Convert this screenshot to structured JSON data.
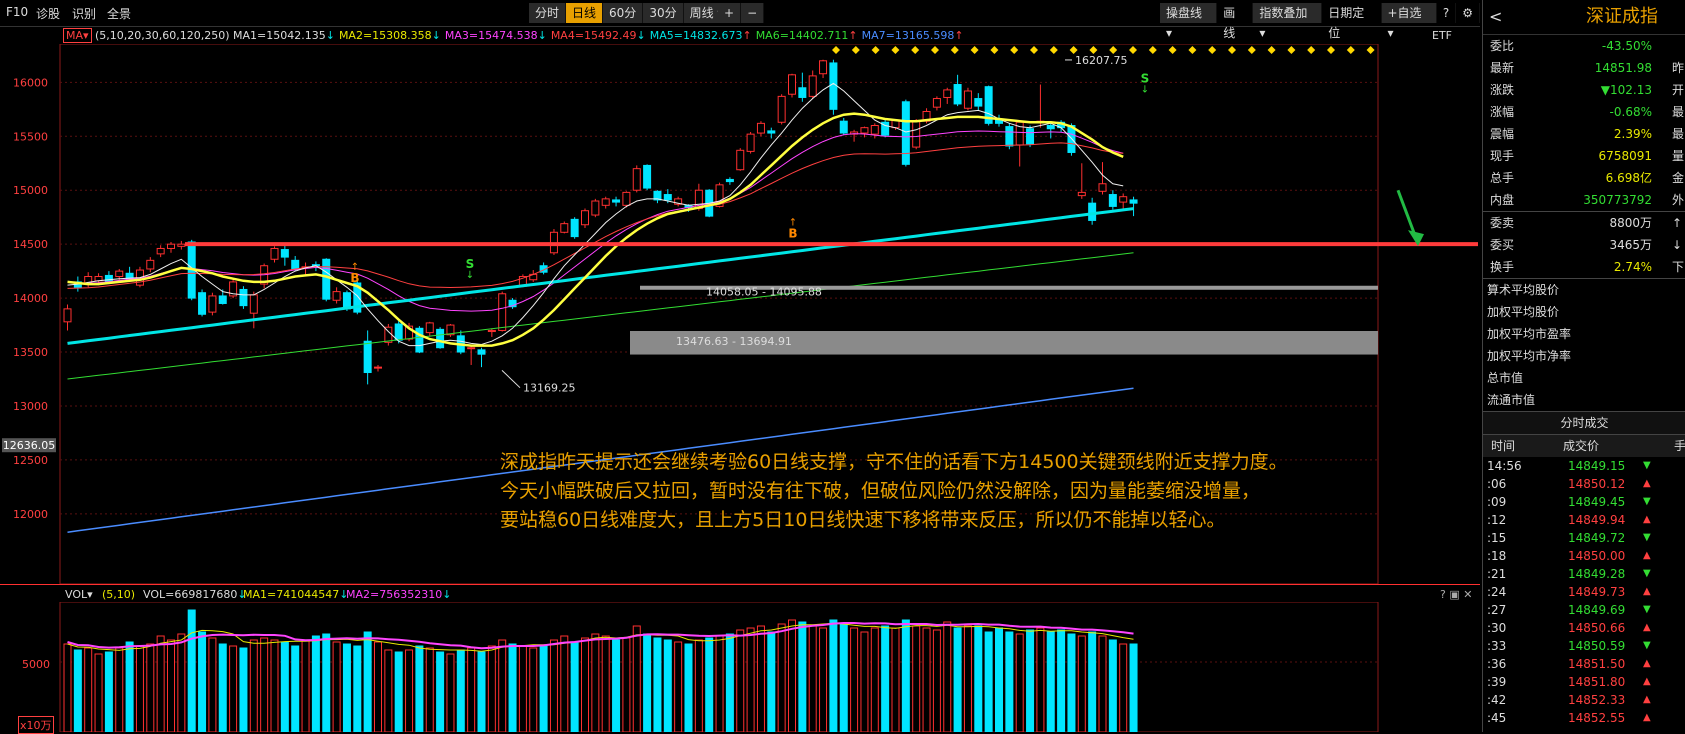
{
  "toolbar": {
    "f10": "F10",
    "diagnose": "诊股",
    "identify": "识别",
    "fullscreen": "全景",
    "periods": [
      "分时",
      "日线",
      "60分",
      "30分",
      "周线"
    ],
    "period_active": 1,
    "plus": "+",
    "minus": "−",
    "right_buttons": [
      "操盘线",
      "画线",
      "指数叠加",
      "日期定位",
      "+自选"
    ],
    "help": "?",
    "settings": "⚙"
  },
  "ma_bar": {
    "selector": "MA",
    "params": "(5,10,20,30,60,120,250)",
    "items": [
      {
        "text": "MA1=15042.135",
        "arrow": "↓",
        "color": "#dddddd"
      },
      {
        "text": "MA2=15308.358",
        "arrow": "↓",
        "color": "#e8e800"
      },
      {
        "text": "MA3=15474.538",
        "arrow": "↓",
        "color": "#ff44ff"
      },
      {
        "text": "MA4=15492.49",
        "arrow": "↓",
        "color": "#ff4040"
      },
      {
        "text": "MA5=14832.673",
        "arrow": "↑",
        "color": "#00e5e5"
      },
      {
        "text": "MA6=14402.711",
        "arrow": "↑",
        "color": "#33dd33"
      },
      {
        "text": "MA7=13165.598",
        "arrow": "↑",
        "color": "#4a8cff"
      }
    ],
    "etf": "ETF"
  },
  "chart": {
    "y_ticks": [
      "16000",
      "15500",
      "15000",
      "14500",
      "14000",
      "13500",
      "13000",
      "12500",
      "12000"
    ],
    "current_price_tag": "12636.05",
    "labels": {
      "high": "16207.75",
      "low": "13169.25",
      "zone1": "14058.05 - 14095.88",
      "zone2": "13476.63 - 13694.91"
    },
    "signals": [
      "S",
      "S",
      "B",
      "B"
    ],
    "support_level": 14500,
    "colors": {
      "up": "#ff3030",
      "down": "#00e5ff",
      "bg": "#000000",
      "support": "#ff3b3b"
    }
  },
  "chart_data": {
    "type": "candlestick",
    "ylim": [
      11850,
      16300
    ],
    "candles": [
      [
        13780,
        13900,
        13700,
        13940
      ],
      [
        14150,
        14100,
        14060,
        14200
      ],
      [
        14130,
        14200,
        14100,
        14240
      ],
      [
        14160,
        14200,
        14120,
        14230
      ],
      [
        14210,
        14150,
        14130,
        14250
      ],
      [
        14200,
        14250,
        14150,
        14270
      ],
      [
        14230,
        14180,
        14150,
        14290
      ],
      [
        14120,
        14260,
        14100,
        14290
      ],
      [
        14270,
        14350,
        14240,
        14380
      ],
      [
        14410,
        14460,
        14380,
        14490
      ],
      [
        14460,
        14500,
        14420,
        14520
      ],
      [
        14480,
        14500,
        14450,
        14530
      ],
      [
        14520,
        14000,
        13980,
        14540
      ],
      [
        14050,
        13850,
        13830,
        14080
      ],
      [
        13870,
        14020,
        13840,
        14050
      ],
      [
        14020,
        13950,
        13940,
        14080
      ],
      [
        14020,
        14150,
        14000,
        14180
      ],
      [
        14080,
        13930,
        13900,
        14110
      ],
      [
        13860,
        14030,
        13720,
        14060
      ],
      [
        14130,
        14300,
        14090,
        14320
      ],
      [
        14360,
        14460,
        14330,
        14480
      ],
      [
        14450,
        14380,
        14300,
        14500
      ],
      [
        14350,
        14270,
        14250,
        14390
      ],
      [
        14280,
        14290,
        14200,
        14330
      ],
      [
        14310,
        14300,
        14250,
        14340
      ],
      [
        14360,
        13990,
        13970,
        14370
      ],
      [
        13980,
        14060,
        13950,
        14100
      ],
      [
        14050,
        13900,
        13880,
        14070
      ],
      [
        14140,
        13870,
        13850,
        14180
      ],
      [
        13600,
        13310,
        13200,
        13700
      ],
      [
        13360,
        13360,
        13320,
        13380
      ],
      [
        13590,
        13730,
        13560,
        13760
      ],
      [
        13760,
        13610,
        13580,
        13790
      ],
      [
        13620,
        13740,
        13600,
        13770
      ],
      [
        13720,
        13500,
        13490,
        13740
      ],
      [
        13680,
        13770,
        13650,
        13780
      ],
      [
        13710,
        13540,
        13530,
        13730
      ],
      [
        13660,
        13750,
        13640,
        13760
      ],
      [
        13650,
        13500,
        13480,
        13700
      ],
      [
        13540,
        13540,
        13380,
        13560
      ],
      [
        13520,
        13480,
        13360,
        13540
      ],
      [
        13690,
        13700,
        13640,
        13720
      ],
      [
        13700,
        14040,
        13690,
        14060
      ],
      [
        13980,
        13920,
        13900,
        14000
      ],
      [
        14110,
        14200,
        14100,
        14220
      ],
      [
        14170,
        14220,
        14150,
        14260
      ],
      [
        14300,
        14240,
        14220,
        14330
      ],
      [
        14420,
        14610,
        14400,
        14640
      ],
      [
        14610,
        14690,
        14600,
        14710
      ],
      [
        14730,
        14570,
        14550,
        14750
      ],
      [
        14680,
        14810,
        14650,
        14830
      ],
      [
        14770,
        14900,
        14750,
        14920
      ],
      [
        14860,
        14920,
        14830,
        14940
      ],
      [
        14910,
        14890,
        14850,
        14940
      ],
      [
        14860,
        14980,
        14840,
        14990
      ],
      [
        15000,
        15200,
        14980,
        15230
      ],
      [
        15230,
        15020,
        15000,
        15240
      ],
      [
        14990,
        14910,
        14880,
        15000
      ],
      [
        14960,
        14910,
        14880,
        15010
      ],
      [
        14870,
        14920,
        14850,
        14940
      ],
      [
        14860,
        14840,
        14800,
        14870
      ],
      [
        14830,
        15000,
        14810,
        15060
      ],
      [
        15000,
        14760,
        14750,
        15010
      ],
      [
        14850,
        15050,
        14840,
        15070
      ],
      [
        15100,
        15080,
        15050,
        15120
      ],
      [
        15190,
        15370,
        15180,
        15390
      ],
      [
        15360,
        15520,
        15340,
        15540
      ],
      [
        15530,
        15620,
        15500,
        15640
      ],
      [
        15550,
        15530,
        15480,
        15580
      ],
      [
        15630,
        15870,
        15610,
        15890
      ],
      [
        15890,
        16070,
        15860,
        16080
      ],
      [
        15950,
        15860,
        15820,
        16090
      ],
      [
        15870,
        16060,
        15850,
        16110
      ],
      [
        16080,
        16200,
        16040,
        16210
      ],
      [
        16180,
        15750,
        15700,
        16210
      ],
      [
        15640,
        15530,
        15510,
        15670
      ],
      [
        15520,
        15540,
        15450,
        15560
      ],
      [
        15530,
        15580,
        15490,
        15590
      ],
      [
        15520,
        15600,
        15480,
        15620
      ],
      [
        15630,
        15510,
        15490,
        15650
      ],
      [
        15580,
        15650,
        15560,
        15660
      ],
      [
        15820,
        15240,
        15220,
        15840
      ],
      [
        15400,
        15640,
        15380,
        15660
      ],
      [
        15640,
        15730,
        15620,
        15760
      ],
      [
        15770,
        15850,
        15740,
        15870
      ],
      [
        15860,
        15930,
        15800,
        15950
      ],
      [
        15980,
        15800,
        15780,
        16070
      ],
      [
        15760,
        15920,
        15740,
        15950
      ],
      [
        15850,
        15780,
        15740,
        15900
      ],
      [
        15960,
        15620,
        15600,
        15970
      ],
      [
        15660,
        15620,
        15590,
        15700
      ],
      [
        15590,
        15410,
        15380,
        15620
      ],
      [
        15420,
        15630,
        15220,
        15650
      ],
      [
        15570,
        15430,
        15400,
        15600
      ],
      [
        15630,
        15640,
        15580,
        15980
      ],
      [
        15600,
        15570,
        15480,
        15640
      ],
      [
        15630,
        15580,
        15540,
        15650
      ],
      [
        15600,
        15350,
        15320,
        15620
      ],
      [
        14950,
        14980,
        14920,
        15250
      ],
      [
        14880,
        14720,
        14680,
        14930
      ],
      [
        14990,
        15060,
        14960,
        15260
      ],
      [
        14960,
        14850,
        14820,
        15000
      ],
      [
        14890,
        14940,
        14820,
        14970
      ],
      [
        14910,
        14880,
        14760,
        14940
      ]
    ],
    "ma_series": {
      "white": [
        14120,
        14130,
        14145,
        14160,
        14170,
        14180,
        14185,
        14190,
        14220,
        14270,
        14320,
        14360,
        14280,
        14200,
        14130,
        14060,
        14040,
        14030,
        14030,
        14080,
        14140,
        14200,
        14250,
        14280,
        14300,
        14240,
        14170,
        14100,
        14020,
        13900,
        13790,
        13690,
        13600,
        13560,
        13560,
        13580,
        13600,
        13610,
        13600,
        13580,
        13570,
        13600,
        13650,
        13720,
        13820,
        13930,
        14050,
        14180,
        14300,
        14400,
        14500,
        14600,
        14700,
        14780,
        14850,
        14900,
        14920,
        14920,
        14900,
        14880,
        14860,
        14870,
        14880,
        14900,
        14950,
        15050,
        15170,
        15300,
        15420,
        15530,
        15650,
        15760,
        15850,
        15930,
        15990,
        15920,
        15830,
        15740,
        15650,
        15600,
        15580,
        15540,
        15560,
        15600,
        15650,
        15700,
        15720,
        15730,
        15740,
        15710,
        15660,
        15620,
        15590,
        15580,
        15600,
        15620,
        15580,
        15480,
        15370,
        15260,
        15140,
        15060,
        15040
      ],
      "yellow": [
        14150,
        14140,
        14130,
        14130,
        14140,
        14150,
        14160,
        14170,
        14190,
        14220,
        14250,
        14280,
        14270,
        14250,
        14230,
        14200,
        14180,
        14160,
        14150,
        14150,
        14160,
        14180,
        14200,
        14210,
        14220,
        14200,
        14170,
        14140,
        14110,
        14050,
        13970,
        13890,
        13800,
        13720,
        13660,
        13620,
        13600,
        13580,
        13570,
        13560,
        13560,
        13560,
        13580,
        13610,
        13660,
        13720,
        13800,
        13890,
        13990,
        14090,
        14190,
        14290,
        14390,
        14480,
        14560,
        14630,
        14690,
        14740,
        14780,
        14800,
        14820,
        14840,
        14860,
        14880,
        14920,
        14980,
        15050,
        15140,
        15230,
        15320,
        15410,
        15490,
        15560,
        15620,
        15670,
        15700,
        15710,
        15700,
        15680,
        15660,
        15650,
        15640,
        15640,
        15650,
        15660,
        15670,
        15680,
        15680,
        15680,
        15670,
        15660,
        15650,
        15640,
        15630,
        15630,
        15630,
        15620,
        15590,
        15530,
        15470,
        15400,
        15350,
        15310
      ]
    }
  },
  "volume": {
    "header_selector": "VOL",
    "params": "(5,10)",
    "vol": "VOL=669817680",
    "vol_arrow": "↓",
    "ma1": "MA1=741044547",
    "ma1_arrow": "↓",
    "ma2": "MA2=756352310",
    "ma2_arrow": "↓",
    "y_tick": "5000",
    "unit": "x10万",
    "icons": "? ▣ ✕"
  },
  "annotation": {
    "lines": [
      "深成指昨天提示还会继续考验60日线支撑，守不住的话看下方14500关键颈线附近支撑力度。",
      "今天小幅跌破后又拉回，暂时没有往下破，但破位风险仍然没解除，因为量能萎缩没增量，",
      "要站稳60日线难度大，且上方5日10日线快速下移将带来反压，所以仍不能掉以轻心。"
    ]
  },
  "panel": {
    "back": "<",
    "title": "深证成指",
    "quote_rows": [
      {
        "k": "委比",
        "v": "-43.50%",
        "vc": "green",
        "e": ""
      },
      {
        "k": "最新",
        "v": "14851.98",
        "vc": "green",
        "e": "昨"
      },
      {
        "k": "涨跌",
        "v": "▼102.13",
        "vc": "green",
        "e": "开"
      },
      {
        "k": "涨幅",
        "v": "-0.68%",
        "vc": "green",
        "e": "最"
      },
      {
        "k": "震幅",
        "v": "2.39%",
        "vc": "yellow",
        "e": "最"
      },
      {
        "k": "现手",
        "v": "6758091",
        "vc": "yellow",
        "e": "量"
      },
      {
        "k": "总手",
        "v": "6.698亿",
        "vc": "yellow",
        "e": "金"
      },
      {
        "k": "内盘",
        "v": "350773792",
        "vc": "green",
        "e": "外"
      }
    ],
    "order_rows": [
      {
        "k": "委卖",
        "v": "8800万",
        "vc": "white",
        "e": "↑"
      },
      {
        "k": "委买",
        "v": "3465万",
        "vc": "white",
        "e": "↓"
      },
      {
        "k": "换手",
        "v": "2.74%",
        "vc": "yellow",
        "e": "下"
      }
    ],
    "index_items": [
      "算术平均股价",
      "加权平均股价",
      "加权平均市盈率",
      "加权平均市净率",
      "总市值",
      "流通市值"
    ],
    "trades_title": "分时成交",
    "trades_header": {
      "time": "时间",
      "price": "成交价",
      "extra": "手"
    },
    "trades": [
      {
        "t": "14:56",
        "p": "14849.15",
        "d": "▼"
      },
      {
        "t": ":06",
        "p": "14850.12",
        "d": "▲"
      },
      {
        "t": ":09",
        "p": "14849.45",
        "d": "▼"
      },
      {
        "t": ":12",
        "p": "14849.94",
        "d": "▲"
      },
      {
        "t": ":15",
        "p": "14849.72",
        "d": "▼"
      },
      {
        "t": ":18",
        "p": "14850.00",
        "d": "▲"
      },
      {
        "t": ":21",
        "p": "14849.28",
        "d": "▼"
      },
      {
        "t": ":24",
        "p": "14849.73",
        "d": "▲"
      },
      {
        "t": ":27",
        "p": "14849.69",
        "d": "▼"
      },
      {
        "t": ":30",
        "p": "14850.66",
        "d": "▲"
      },
      {
        "t": ":33",
        "p": "14850.59",
        "d": "▼"
      },
      {
        "t": ":36",
        "p": "14851.50",
        "d": "▲"
      },
      {
        "t": ":39",
        "p": "14851.80",
        "d": "▲"
      },
      {
        "t": ":42",
        "p": "14852.33",
        "d": "▲"
      },
      {
        "t": ":45",
        "p": "14852.55",
        "d": "▲"
      }
    ]
  }
}
